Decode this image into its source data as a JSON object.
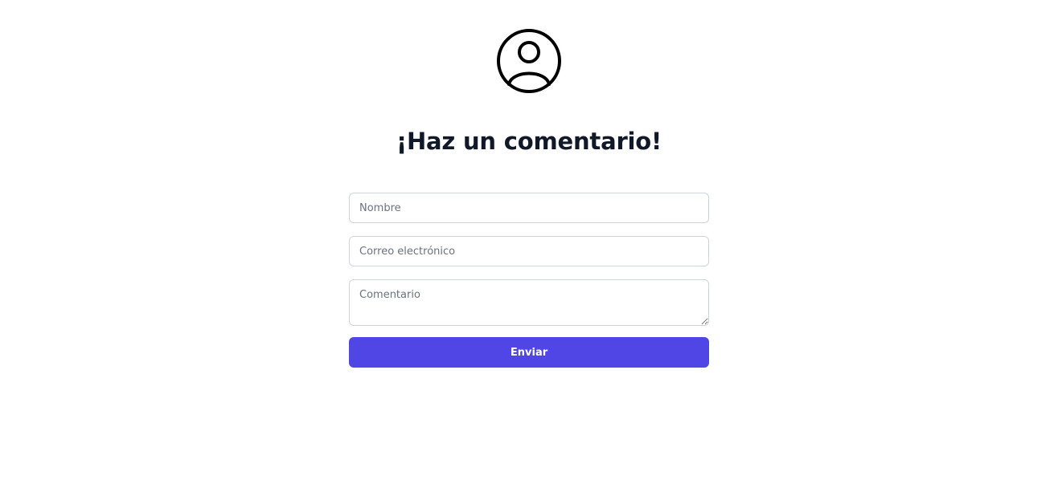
{
  "header": {
    "avatar_icon": "user-circle-icon",
    "title": "¡Haz un comentario!"
  },
  "form": {
    "name_placeholder": "Nombre",
    "email_placeholder": "Correo electrónico",
    "comment_placeholder": "Comentario",
    "submit_label": "Enviar"
  },
  "colors": {
    "accent": "#4f46e5",
    "title": "#111827",
    "field_border": "#cfd4dc",
    "placeholder": "#6b7280",
    "background": "#ffffff"
  }
}
